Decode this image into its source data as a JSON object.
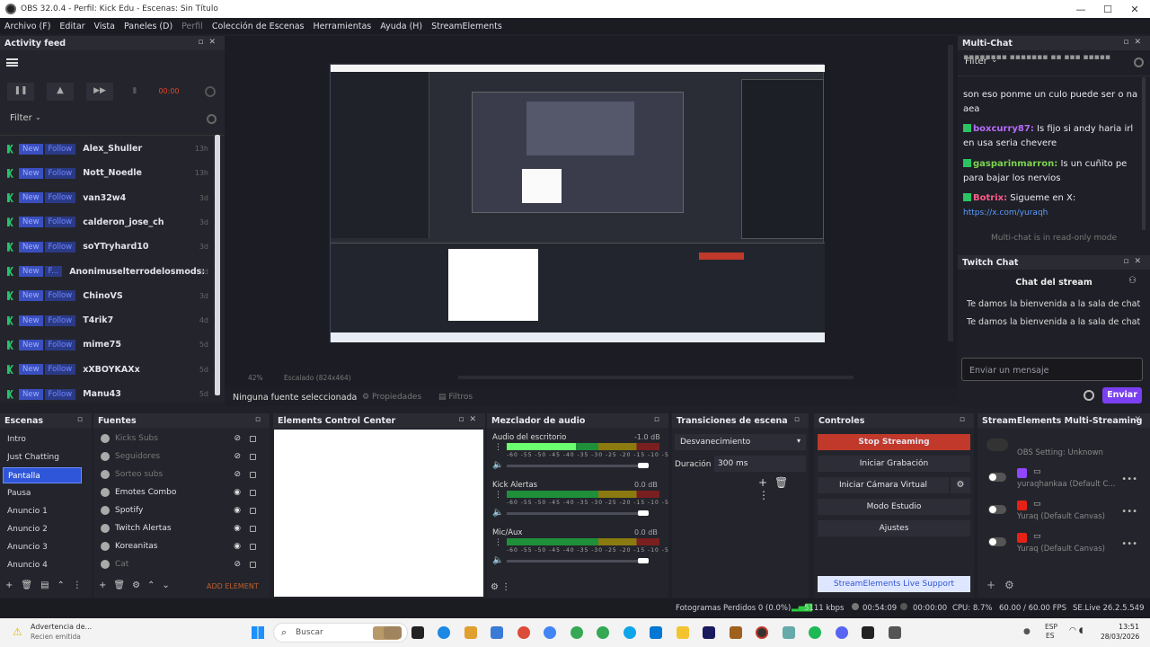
{
  "window": {
    "title": "OBS 32.0.4 - Perfil: Kick Edu - Escenas: Sin Título",
    "controls": [
      "—",
      "☐",
      "✕"
    ]
  },
  "menu": [
    "Archivo (F)",
    "Editar",
    "Vista",
    "Paneles (D)",
    "Perfil",
    "Colección de Escenas",
    "Herramientas",
    "Ayuda (H)",
    "StreamElements"
  ],
  "activity_feed": {
    "title": "Activity feed",
    "filter_label": "Filter",
    "record_time": "00:00",
    "events": [
      {
        "badge": "New",
        "type": "Follow",
        "name": "Alex_Shuller",
        "time": "13h"
      },
      {
        "badge": "New",
        "type": "Follow",
        "name": "Nott_Noedle",
        "time": "13h"
      },
      {
        "badge": "New",
        "type": "Follow",
        "name": "van32w4",
        "time": "3d"
      },
      {
        "badge": "New",
        "type": "Follow",
        "name": "calderon_jose_ch",
        "time": "3d"
      },
      {
        "badge": "New",
        "type": "Follow",
        "name": "soYTryhard10",
        "time": "3d"
      },
      {
        "badge": "New",
        "type": "F...",
        "name": "Anonimuselterrodelosmods:",
        "time": "3d"
      },
      {
        "badge": "New",
        "type": "Follow",
        "name": "ChinoVS",
        "time": "3d"
      },
      {
        "badge": "New",
        "type": "Follow",
        "name": "T4rik7",
        "time": "4d"
      },
      {
        "badge": "New",
        "type": "Follow",
        "name": "mime75",
        "time": "5d"
      },
      {
        "badge": "New",
        "type": "Follow",
        "name": "xXBOYKAXx",
        "time": "5d"
      },
      {
        "badge": "New",
        "type": "Follow",
        "name": "Manu43",
        "time": "5d"
      }
    ]
  },
  "preview": {
    "zoom": "42%",
    "scaling": "Escalado (824x464)",
    "no_source": "Ninguna fuente seleccionada",
    "properties": "Propiedades",
    "filters": "Filtros"
  },
  "multichat": {
    "title": "Multi-Chat",
    "filter_label": "Filter",
    "messages": [
      {
        "user": "",
        "text": "son eso ponme un culo puede ser o na aea"
      },
      {
        "user": "boxcurry87:",
        "text": "Is fijo si andy haria irl en usa seria chevere"
      },
      {
        "user": "gasparinmarron:",
        "text": "Is un cuñito pe para bajar los nervios"
      },
      {
        "user": "Botrix:",
        "text": "Sigueme en X:",
        "link": "https://x.com/yuraqh"
      }
    ],
    "readonly_note": "Multi-chat is in read-only mode"
  },
  "twitch_chat": {
    "title": "Twitch Chat",
    "header": "Chat del stream",
    "welcome_1": "Te damos la bienvenida a la sala de chat",
    "welcome_2": "Te damos la bienvenida a la sala de chat",
    "input_placeholder": "Enviar un mensaje",
    "send_label": "Enviar"
  },
  "scenes": {
    "title": "Escenas",
    "items": [
      "Intro",
      "Just Chatting",
      "Pantalla",
      "Pausa",
      "Anuncio 1",
      "Anuncio 2",
      "Anuncio 3",
      "Anuncio 4"
    ],
    "selected": "Pantalla"
  },
  "sources": {
    "title": "Fuentes",
    "items": [
      "Kicks Subs",
      "Seguidores",
      "Sorteo subs",
      "Emotes Combo",
      "Spotify",
      "Twitch Alertas",
      "Koreanitas",
      "Cat"
    ],
    "add_element": "ADD ELEMENT"
  },
  "elements_control": {
    "title": "Elements Control Center"
  },
  "mixer": {
    "title": "Mezclador de audio",
    "scale": "-60 -55 -50 -45 -40 -35 -30 -25 -20 -15 -10 -5 0",
    "channels": [
      {
        "name": "Audio del escritorio",
        "db": "-1.0 dB",
        "level": 0.45
      },
      {
        "name": "Kick Alertas",
        "db": "0.0 dB",
        "level": 0.0
      },
      {
        "name": "Mic/Aux",
        "db": "0.0 dB",
        "level": 0.0
      }
    ]
  },
  "transitions": {
    "title": "Transiciones de escena",
    "selected": "Desvanecimiento",
    "duration_label": "Duración",
    "duration_value": "300 ms"
  },
  "controls": {
    "title": "Controles",
    "stop_streaming": "Stop Streaming",
    "start_recording": "Iniciar Grabación",
    "start_virtual_cam": "Iniciar Cámara Virtual",
    "studio_mode": "Modo Estudio",
    "settings": "Ajustes",
    "support": "StreamElements Live Support"
  },
  "se_multistream": {
    "title": "StreamElements Multi-Streaming",
    "obs_setting": "OBS Setting: Unknown",
    "outputs": [
      {
        "name": "yuraqhankaa (Default C...",
        "platform": "twitch"
      },
      {
        "name": "Yuraq (Default Canvas)",
        "platform": "youtube"
      },
      {
        "name": "Yuraq (Default Canvas)",
        "platform": "youtube"
      }
    ]
  },
  "statusbar": {
    "dropped": "Fotogramas Perdidos 0 (0.0%)",
    "bitrate": "5111 kbps",
    "stream_time": "00:54:09",
    "rec_time": "00:00:00",
    "cpu": "CPU: 8.7%",
    "fps": "60.00 / 60.00 FPS",
    "version": "SE.Live 26.2.5.549"
  },
  "taskbar": {
    "notification_title": "Advertencia de...",
    "notification_sub": "Recien emitida",
    "search_placeholder": "Buscar",
    "lang": "ESP",
    "lang2": "ES",
    "clock": "13:51",
    "date": "28/03/2026"
  },
  "colors": {
    "accent": "#2f56d8",
    "stop": "#c0392b",
    "enviar": "#7b3ff2",
    "kick_green": "#27c46b"
  }
}
